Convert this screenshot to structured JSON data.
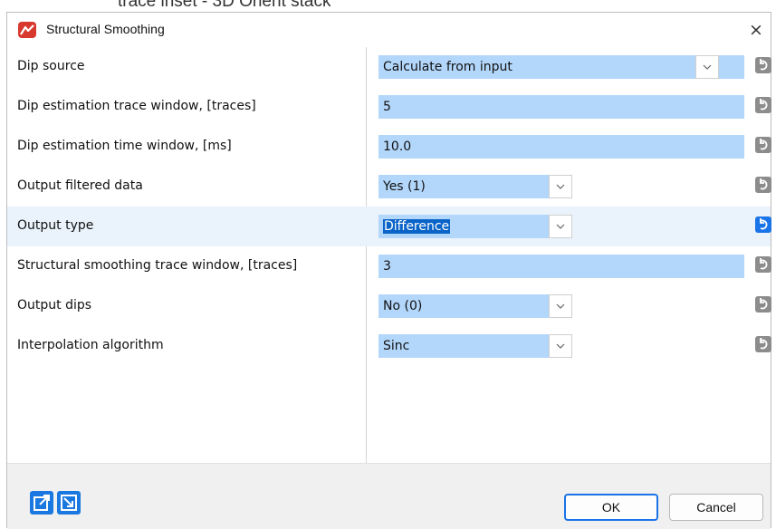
{
  "background": {
    "partial_text": "trace inset - 3D Orient stack"
  },
  "dialog": {
    "title": "Structural Smoothing",
    "close_glyph": "×",
    "accent_color": "#1a73e8",
    "selection_color": "#0a64c8",
    "field_color": "#b3d7fb"
  },
  "rows": [
    {
      "label": "Dip source",
      "value": "Calculate from input",
      "kind": "combo"
    },
    {
      "label": "Dip estimation trace window, [traces]",
      "value": "5",
      "kind": "text"
    },
    {
      "label": "Dip estimation time window, [ms]",
      "value": "10.0",
      "kind": "text"
    },
    {
      "label": "Output filtered data",
      "value": "Yes (1)",
      "kind": "combo"
    },
    {
      "label": "Output type",
      "value": "Difference",
      "kind": "combo",
      "selected": true
    },
    {
      "label": "Structural smoothing trace window, [traces]",
      "value": "3",
      "kind": "text"
    },
    {
      "label": "Output dips",
      "value": "No (0)",
      "kind": "combo"
    },
    {
      "label": "Interpolation algorithm",
      "value": "Sinc",
      "kind": "combo"
    }
  ],
  "icons": {
    "dropdown": "chevron-down-icon",
    "reset": "reset-arrow-icon",
    "export": "export-icon",
    "import": "import-icon"
  },
  "footer": {
    "ok_label": "OK",
    "cancel_label": "Cancel"
  }
}
